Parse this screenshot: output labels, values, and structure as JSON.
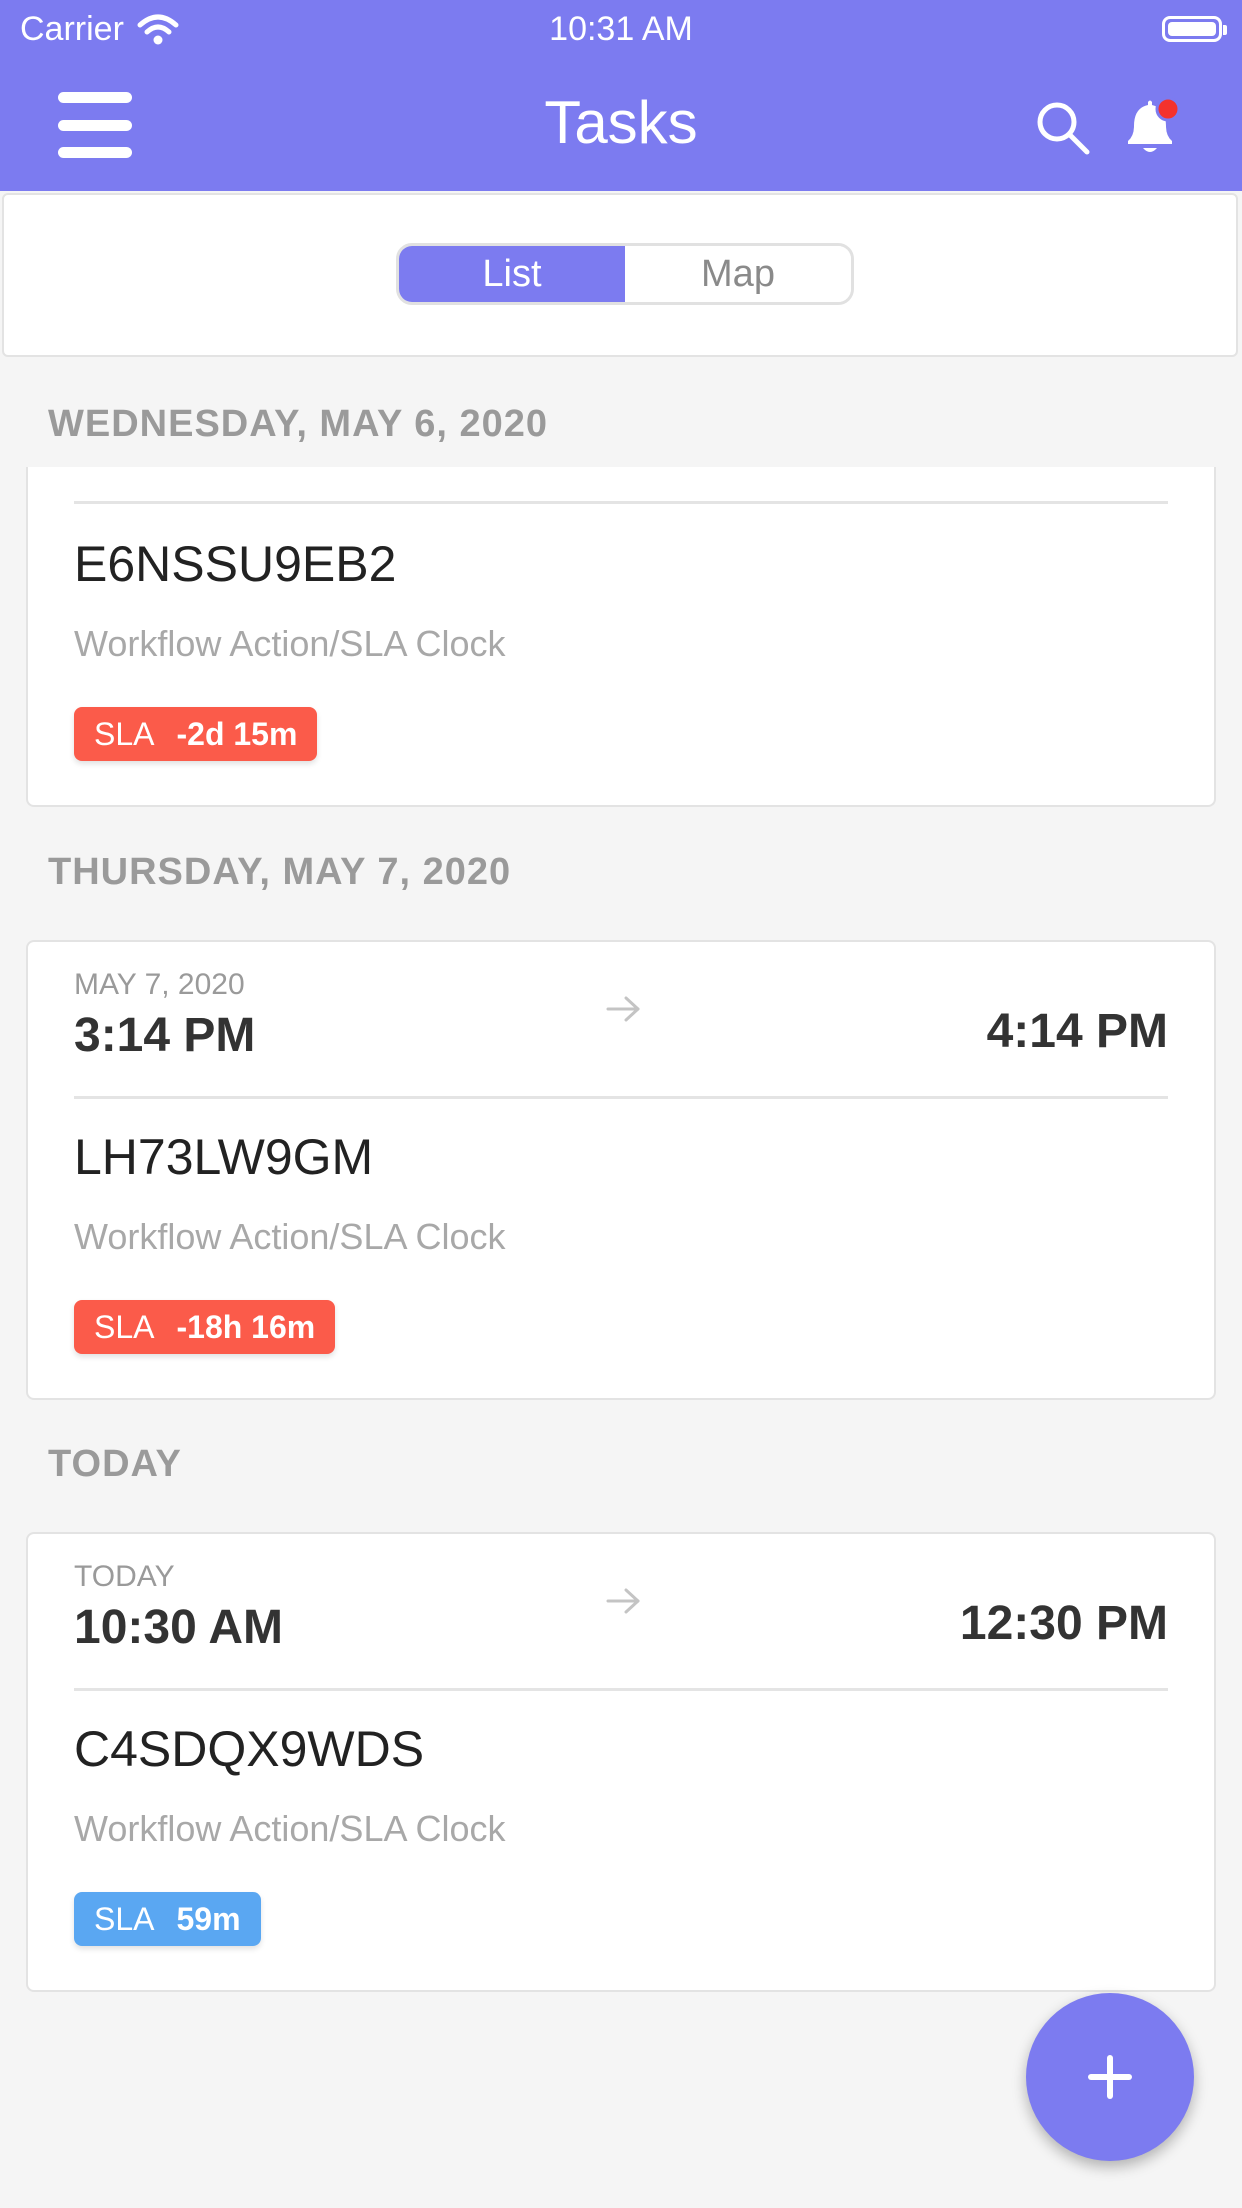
{
  "status_bar": {
    "carrier": "Carrier",
    "time": "10:31 AM"
  },
  "nav": {
    "title": "Tasks"
  },
  "segment": {
    "options": [
      "List",
      "Map"
    ],
    "selected": "List"
  },
  "sections": [
    {
      "header": "WEDNESDAY, MAY 6, 2020"
    },
    {
      "header": "THURSDAY, MAY 7, 2020"
    },
    {
      "header": "TODAY"
    }
  ],
  "tasks": [
    {
      "id": "E6NSSU9EB2",
      "description": "Workflow Action/SLA Clock",
      "sla_label": "SLA",
      "sla_value": "-2d 15m",
      "sla_color": "#fb5b4a"
    },
    {
      "date": "MAY 7, 2020",
      "start": "3:14 PM",
      "end": "4:14 PM",
      "id": "LH73LW9GM",
      "description": "Workflow Action/SLA Clock",
      "sla_label": "SLA",
      "sla_value": "-18h 16m",
      "sla_color": "#fb5b4a"
    },
    {
      "date": "TODAY",
      "start": "10:30 AM",
      "end": "12:30 PM",
      "id": "C4SDQX9WDS",
      "description": "Workflow Action/SLA Clock",
      "sla_label": "SLA",
      "sla_value": "59m",
      "sla_color": "#5aa7f2"
    }
  ],
  "colors": {
    "accent": "#7c7bf0",
    "notification_dot": "#f4322d"
  },
  "icons": [
    "wifi-icon",
    "battery-icon",
    "menu-icon",
    "search-icon",
    "bell-icon",
    "arrow-right-icon",
    "plus-icon"
  ]
}
